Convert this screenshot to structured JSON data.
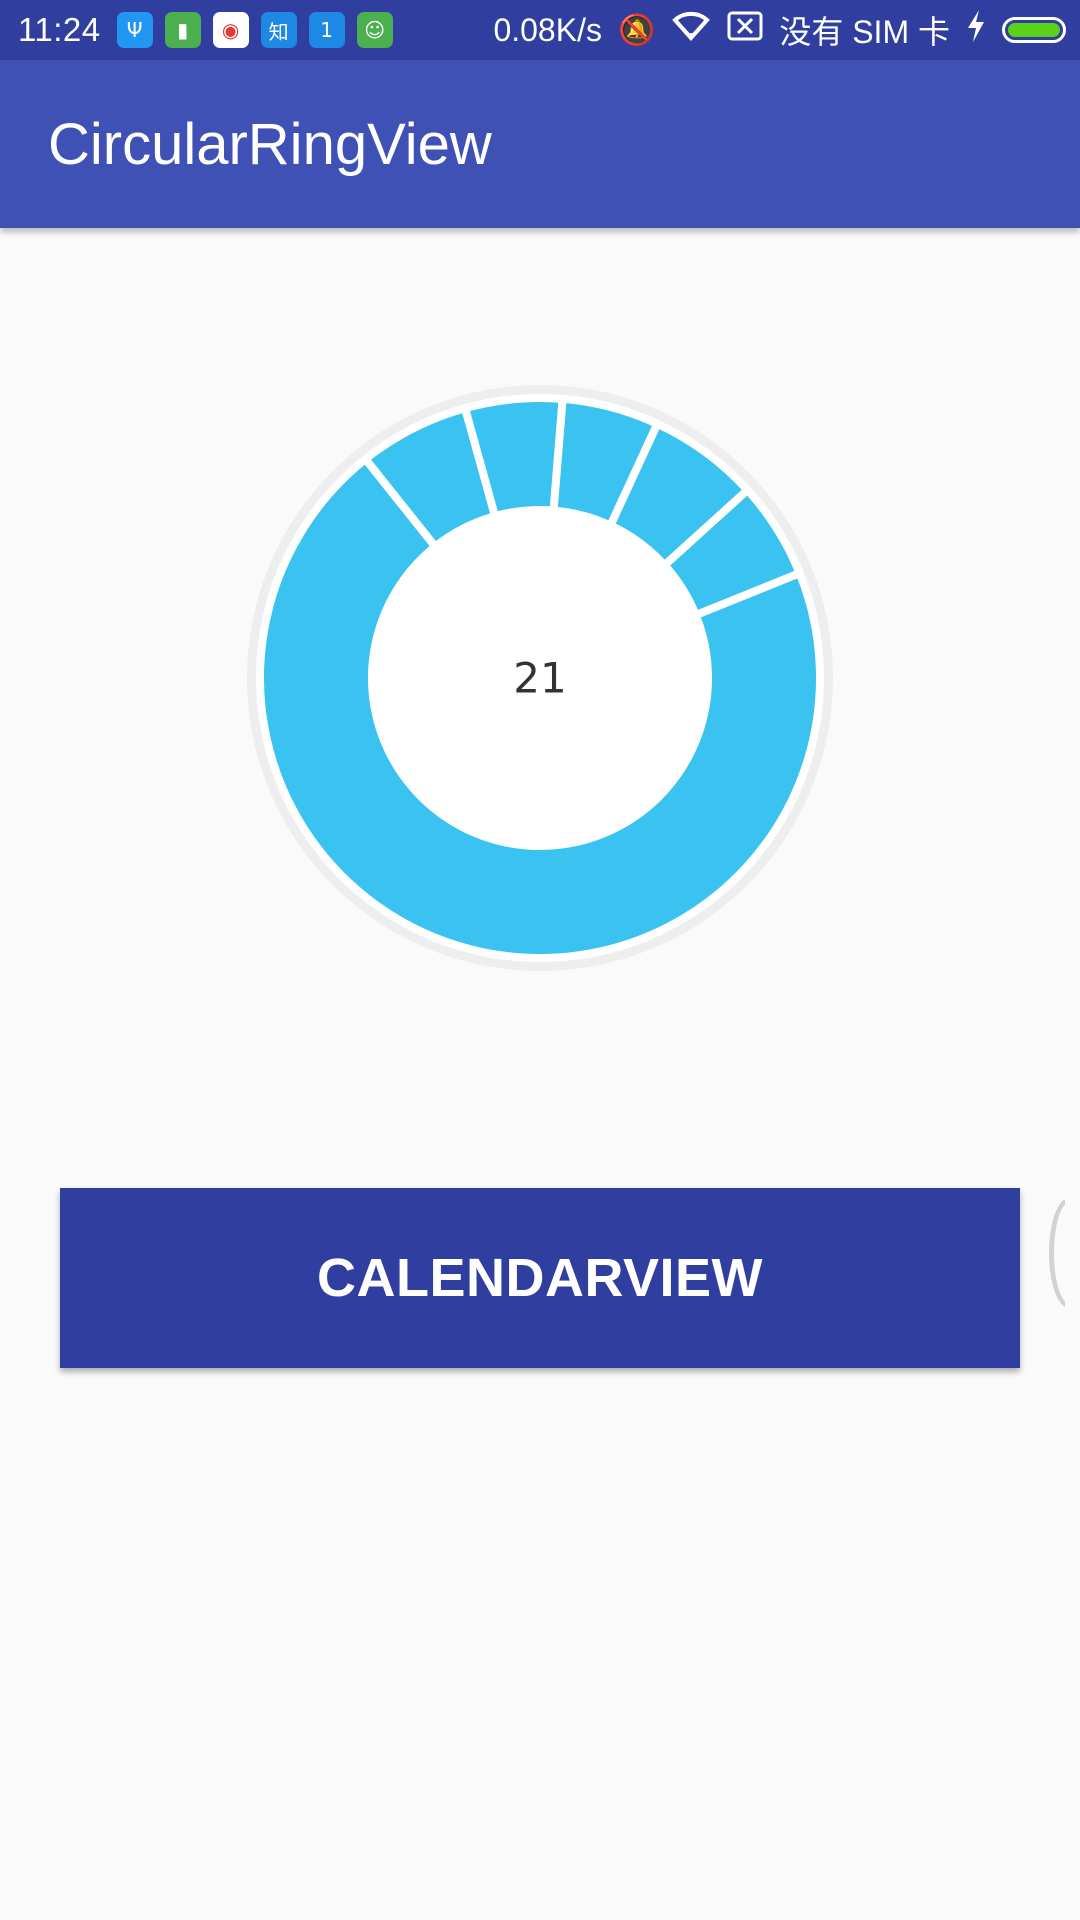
{
  "status_bar": {
    "time": "11:24",
    "notification_icons": [
      {
        "icon": "usb-icon",
        "glyph": "Ψ",
        "color": "#2196f3"
      },
      {
        "icon": "battery-app-icon",
        "glyph": "▮",
        "color": "#4caf50"
      },
      {
        "icon": "weibo-icon",
        "glyph": "◉",
        "color": "#ffffff"
      },
      {
        "icon": "zhihu-icon",
        "glyph": "知",
        "color": "#1e88e5"
      },
      {
        "icon": "calendar-app-icon",
        "glyph": "1",
        "color": "#1e88e5"
      },
      {
        "icon": "android-app-icon",
        "glyph": "☺",
        "color": "#4caf50"
      }
    ],
    "net_speed": "0.08K/s",
    "no_sim": "没有 SIM 卡",
    "battery_level": 1.0
  },
  "app_bar": {
    "title": "CircularRingView"
  },
  "ring": {
    "center_value": "21",
    "segment_color": "#3ac2f0",
    "track_color": "#eeeeee",
    "segment_values": [
      176,
      16,
      14,
      14,
      16,
      14
    ]
  },
  "button": {
    "label": "CALENDARVIEW"
  },
  "colors": {
    "status_bar": "#303f9f",
    "app_bar": "#3f51b5",
    "button": "#303f9f",
    "background": "#fafafa"
  }
}
